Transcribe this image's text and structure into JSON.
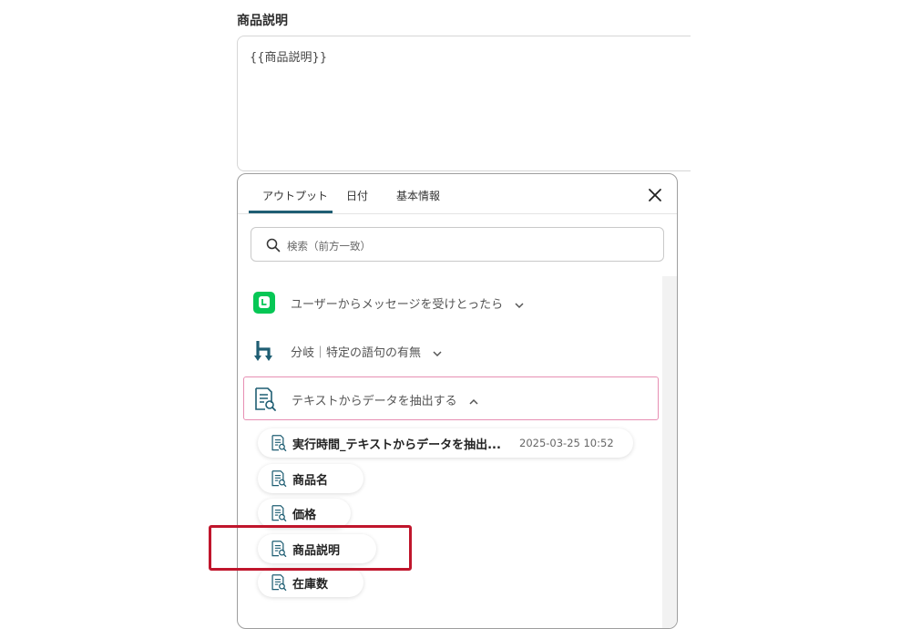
{
  "field": {
    "label": "商品説明",
    "value": "{{商品説明}}"
  },
  "panel": {
    "tabs": [
      {
        "label": "アウトプット",
        "active": true
      },
      {
        "label": "日付",
        "active": false
      },
      {
        "label": "基本情報",
        "active": false
      }
    ],
    "search": {
      "placeholder": "検索（前方一致）",
      "value": ""
    },
    "groups": [
      {
        "label": "ユーザーからメッセージを受けとったら",
        "icon": "line-app-icon",
        "expanded": false
      },
      {
        "label": "分岐｜特定の語句の有無",
        "icon": "branch-icon",
        "expanded": false
      },
      {
        "label": "テキストからデータを抽出する",
        "icon": "extract-doc-icon",
        "expanded": true
      }
    ],
    "items": [
      {
        "label": "実行時間_テキストからデータを抽出...",
        "time": "2025-03-25 10:52"
      },
      {
        "label": "商品名"
      },
      {
        "label": "価格"
      },
      {
        "label": "商品説明",
        "highlighted": true
      },
      {
        "label": "在庫数"
      }
    ]
  },
  "colors": {
    "accent": "#1f5e73",
    "line_green": "#06c755",
    "active_group_border": "#e78fb3",
    "highlight_red": "#c0162c"
  }
}
